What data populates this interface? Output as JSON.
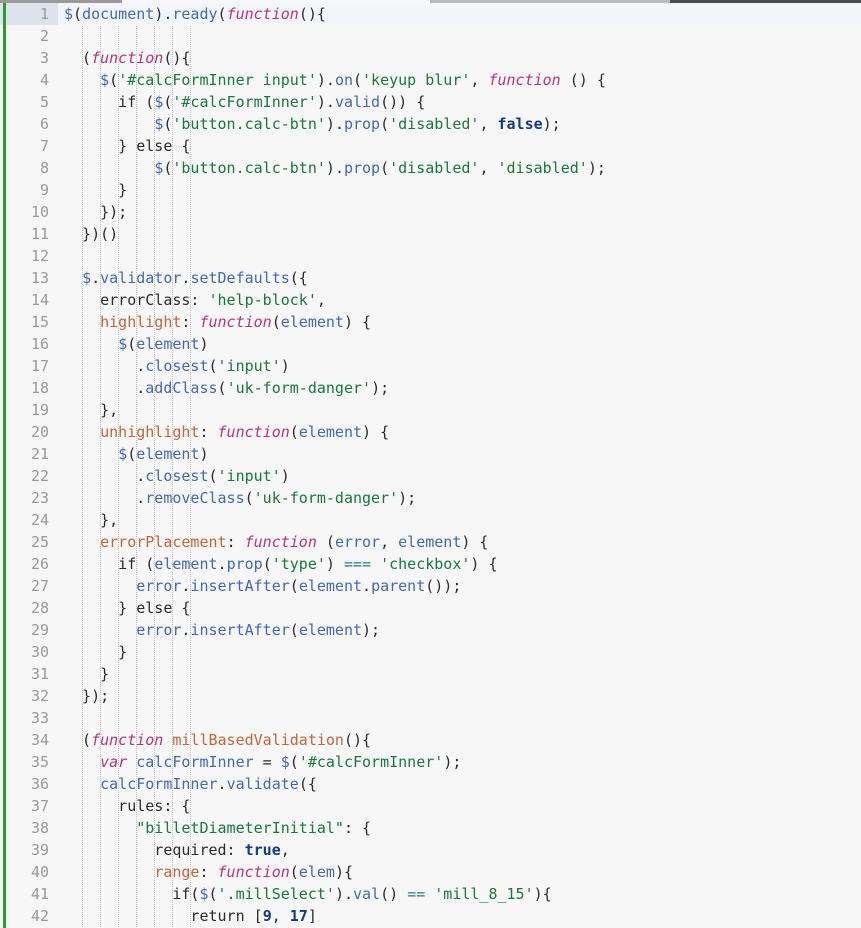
{
  "window": {
    "title": "Code Editor",
    "top_strip_segments": [
      "toolbar-left",
      "toolbar-mid",
      "toolbar-right"
    ]
  },
  "editor": {
    "language": "JavaScript",
    "caret_line": 1,
    "first_visible_line": 1,
    "last_visible_line": 42,
    "line_height_px": 22,
    "vcs_marker": "modified",
    "colors": {
      "background": "#f7f7f7",
      "gutter_text": "#999999",
      "caret_line_gutter": "#dde3ec",
      "vcs_modified": "#2e9b2e",
      "identifier": "#4169b4",
      "string": "#157a3a",
      "keyword": "#b8337e",
      "function_name": "#c1663a",
      "property_key": "#c1663a",
      "constant": "#0f3c84",
      "operator": "#20808d",
      "plain": "#2b2b2b",
      "indent_guide": "#c4c4c4"
    }
  },
  "code": {
    "lines": [
      {
        "n": 1,
        "tokens": [
          {
            "t": "$",
            "c": "ident"
          },
          {
            "t": "(",
            "c": "punc"
          },
          {
            "t": "document",
            "c": "ident"
          },
          {
            "t": ")",
            "c": "punc"
          },
          {
            "t": ".",
            "c": "punc"
          },
          {
            "t": "ready",
            "c": "call"
          },
          {
            "t": "(",
            "c": "punc"
          },
          {
            "t": "function",
            "c": "kw"
          },
          {
            "t": "(){",
            "c": "punc"
          }
        ]
      },
      {
        "n": 2,
        "tokens": []
      },
      {
        "n": 3,
        "tokens": [
          {
            "t": "  (",
            "c": "punc"
          },
          {
            "t": "function",
            "c": "kw"
          },
          {
            "t": "(){",
            "c": "punc"
          }
        ]
      },
      {
        "n": 4,
        "tokens": [
          {
            "t": "    ",
            "c": "plain"
          },
          {
            "t": "$",
            "c": "ident"
          },
          {
            "t": "(",
            "c": "punc"
          },
          {
            "t": "'#calcFormInner input'",
            "c": "str"
          },
          {
            "t": ")",
            "c": "punc"
          },
          {
            "t": ".",
            "c": "punc"
          },
          {
            "t": "on",
            "c": "call"
          },
          {
            "t": "(",
            "c": "punc"
          },
          {
            "t": "'keyup blur'",
            "c": "str"
          },
          {
            "t": ", ",
            "c": "punc"
          },
          {
            "t": "function",
            "c": "kw"
          },
          {
            "t": " () {",
            "c": "punc"
          }
        ]
      },
      {
        "n": 5,
        "tokens": [
          {
            "t": "      if (",
            "c": "plain"
          },
          {
            "t": "$",
            "c": "ident"
          },
          {
            "t": "(",
            "c": "punc"
          },
          {
            "t": "'#calcFormInner'",
            "c": "str"
          },
          {
            "t": ")",
            "c": "punc"
          },
          {
            "t": ".",
            "c": "punc"
          },
          {
            "t": "valid",
            "c": "call"
          },
          {
            "t": "()) {",
            "c": "punc"
          }
        ]
      },
      {
        "n": 6,
        "tokens": [
          {
            "t": "          ",
            "c": "plain"
          },
          {
            "t": "$",
            "c": "ident"
          },
          {
            "t": "(",
            "c": "punc"
          },
          {
            "t": "'button.calc-btn'",
            "c": "str"
          },
          {
            "t": ")",
            "c": "punc"
          },
          {
            "t": ".",
            "c": "punc"
          },
          {
            "t": "prop",
            "c": "call"
          },
          {
            "t": "(",
            "c": "punc"
          },
          {
            "t": "'disabled'",
            "c": "str"
          },
          {
            "t": ", ",
            "c": "punc"
          },
          {
            "t": "false",
            "c": "const"
          },
          {
            "t": ");",
            "c": "punc"
          }
        ]
      },
      {
        "n": 7,
        "tokens": [
          {
            "t": "      } else {",
            "c": "plain"
          }
        ]
      },
      {
        "n": 8,
        "tokens": [
          {
            "t": "          ",
            "c": "plain"
          },
          {
            "t": "$",
            "c": "ident"
          },
          {
            "t": "(",
            "c": "punc"
          },
          {
            "t": "'button.calc-btn'",
            "c": "str"
          },
          {
            "t": ")",
            "c": "punc"
          },
          {
            "t": ".",
            "c": "punc"
          },
          {
            "t": "prop",
            "c": "call"
          },
          {
            "t": "(",
            "c": "punc"
          },
          {
            "t": "'disabled'",
            "c": "str"
          },
          {
            "t": ", ",
            "c": "punc"
          },
          {
            "t": "'disabled'",
            "c": "str"
          },
          {
            "t": ");",
            "c": "punc"
          }
        ]
      },
      {
        "n": 9,
        "tokens": [
          {
            "t": "      }",
            "c": "plain"
          }
        ]
      },
      {
        "n": 10,
        "tokens": [
          {
            "t": "    });",
            "c": "punc"
          }
        ]
      },
      {
        "n": 11,
        "tokens": [
          {
            "t": "  })()",
            "c": "punc"
          }
        ]
      },
      {
        "n": 12,
        "tokens": []
      },
      {
        "n": 13,
        "tokens": [
          {
            "t": "  ",
            "c": "plain"
          },
          {
            "t": "$",
            "c": "ident"
          },
          {
            "t": ".",
            "c": "punc"
          },
          {
            "t": "validator",
            "c": "ident"
          },
          {
            "t": ".",
            "c": "punc"
          },
          {
            "t": "setDefaults",
            "c": "call"
          },
          {
            "t": "({",
            "c": "punc"
          }
        ]
      },
      {
        "n": 14,
        "tokens": [
          {
            "t": "    errorClass: ",
            "c": "plain"
          },
          {
            "t": "'help-block'",
            "c": "str"
          },
          {
            "t": ",",
            "c": "punc"
          }
        ]
      },
      {
        "n": 15,
        "tokens": [
          {
            "t": "    ",
            "c": "plain"
          },
          {
            "t": "highlight",
            "c": "prop"
          },
          {
            "t": ": ",
            "c": "punc"
          },
          {
            "t": "function",
            "c": "kw"
          },
          {
            "t": "(",
            "c": "punc"
          },
          {
            "t": "element",
            "c": "ident"
          },
          {
            "t": ") {",
            "c": "punc"
          }
        ]
      },
      {
        "n": 16,
        "tokens": [
          {
            "t": "      ",
            "c": "plain"
          },
          {
            "t": "$",
            "c": "ident"
          },
          {
            "t": "(",
            "c": "punc"
          },
          {
            "t": "element",
            "c": "ident"
          },
          {
            "t": ")",
            "c": "punc"
          }
        ]
      },
      {
        "n": 17,
        "tokens": [
          {
            "t": "        .",
            "c": "punc"
          },
          {
            "t": "closest",
            "c": "call"
          },
          {
            "t": "(",
            "c": "punc"
          },
          {
            "t": "'input'",
            "c": "str"
          },
          {
            "t": ")",
            "c": "punc"
          }
        ]
      },
      {
        "n": 18,
        "tokens": [
          {
            "t": "        .",
            "c": "punc"
          },
          {
            "t": "addClass",
            "c": "call"
          },
          {
            "t": "(",
            "c": "punc"
          },
          {
            "t": "'uk-form-danger'",
            "c": "str"
          },
          {
            "t": ");",
            "c": "punc"
          }
        ]
      },
      {
        "n": 19,
        "tokens": [
          {
            "t": "    },",
            "c": "punc"
          }
        ]
      },
      {
        "n": 20,
        "tokens": [
          {
            "t": "    ",
            "c": "plain"
          },
          {
            "t": "unhighlight",
            "c": "prop"
          },
          {
            "t": ": ",
            "c": "punc"
          },
          {
            "t": "function",
            "c": "kw"
          },
          {
            "t": "(",
            "c": "punc"
          },
          {
            "t": "element",
            "c": "ident"
          },
          {
            "t": ") {",
            "c": "punc"
          }
        ]
      },
      {
        "n": 21,
        "tokens": [
          {
            "t": "      ",
            "c": "plain"
          },
          {
            "t": "$",
            "c": "ident"
          },
          {
            "t": "(",
            "c": "punc"
          },
          {
            "t": "element",
            "c": "ident"
          },
          {
            "t": ")",
            "c": "punc"
          }
        ]
      },
      {
        "n": 22,
        "tokens": [
          {
            "t": "        .",
            "c": "punc"
          },
          {
            "t": "closest",
            "c": "call"
          },
          {
            "t": "(",
            "c": "punc"
          },
          {
            "t": "'input'",
            "c": "str"
          },
          {
            "t": ")",
            "c": "punc"
          }
        ]
      },
      {
        "n": 23,
        "tokens": [
          {
            "t": "        .",
            "c": "punc"
          },
          {
            "t": "removeClass",
            "c": "call"
          },
          {
            "t": "(",
            "c": "punc"
          },
          {
            "t": "'uk-form-danger'",
            "c": "str"
          },
          {
            "t": ");",
            "c": "punc"
          }
        ]
      },
      {
        "n": 24,
        "tokens": [
          {
            "t": "    },",
            "c": "punc"
          }
        ]
      },
      {
        "n": 25,
        "tokens": [
          {
            "t": "    ",
            "c": "plain"
          },
          {
            "t": "errorPlacement",
            "c": "prop"
          },
          {
            "t": ": ",
            "c": "punc"
          },
          {
            "t": "function",
            "c": "kw"
          },
          {
            "t": " (",
            "c": "punc"
          },
          {
            "t": "error",
            "c": "ident"
          },
          {
            "t": ", ",
            "c": "punc"
          },
          {
            "t": "element",
            "c": "ident"
          },
          {
            "t": ") {",
            "c": "punc"
          }
        ]
      },
      {
        "n": 26,
        "tokens": [
          {
            "t": "      if (",
            "c": "plain"
          },
          {
            "t": "element",
            "c": "ident"
          },
          {
            "t": ".",
            "c": "punc"
          },
          {
            "t": "prop",
            "c": "call"
          },
          {
            "t": "(",
            "c": "punc"
          },
          {
            "t": "'type'",
            "c": "str"
          },
          {
            "t": ") ",
            "c": "punc"
          },
          {
            "t": "===",
            "c": "op"
          },
          {
            "t": " ",
            "c": "punc"
          },
          {
            "t": "'checkbox'",
            "c": "str"
          },
          {
            "t": ") {",
            "c": "punc"
          }
        ]
      },
      {
        "n": 27,
        "tokens": [
          {
            "t": "        ",
            "c": "plain"
          },
          {
            "t": "error",
            "c": "ident"
          },
          {
            "t": ".",
            "c": "punc"
          },
          {
            "t": "insertAfter",
            "c": "call"
          },
          {
            "t": "(",
            "c": "punc"
          },
          {
            "t": "element",
            "c": "ident"
          },
          {
            "t": ".",
            "c": "punc"
          },
          {
            "t": "parent",
            "c": "call"
          },
          {
            "t": "());",
            "c": "punc"
          }
        ]
      },
      {
        "n": 28,
        "tokens": [
          {
            "t": "      } else {",
            "c": "plain"
          }
        ]
      },
      {
        "n": 29,
        "tokens": [
          {
            "t": "        ",
            "c": "plain"
          },
          {
            "t": "error",
            "c": "ident"
          },
          {
            "t": ".",
            "c": "punc"
          },
          {
            "t": "insertAfter",
            "c": "call"
          },
          {
            "t": "(",
            "c": "punc"
          },
          {
            "t": "element",
            "c": "ident"
          },
          {
            "t": ");",
            "c": "punc"
          }
        ]
      },
      {
        "n": 30,
        "tokens": [
          {
            "t": "      }",
            "c": "plain"
          }
        ]
      },
      {
        "n": 31,
        "tokens": [
          {
            "t": "    }",
            "c": "punc"
          }
        ]
      },
      {
        "n": 32,
        "tokens": [
          {
            "t": "  });",
            "c": "punc"
          }
        ]
      },
      {
        "n": 33,
        "tokens": []
      },
      {
        "n": 34,
        "tokens": [
          {
            "t": "  (",
            "c": "punc"
          },
          {
            "t": "function",
            "c": "kw"
          },
          {
            "t": " ",
            "c": "punc"
          },
          {
            "t": "millBasedValidation",
            "c": "fnname"
          },
          {
            "t": "(){",
            "c": "punc"
          }
        ]
      },
      {
        "n": 35,
        "tokens": [
          {
            "t": "    ",
            "c": "plain"
          },
          {
            "t": "var",
            "c": "kw"
          },
          {
            "t": " ",
            "c": "punc"
          },
          {
            "t": "calcFormInner",
            "c": "ident"
          },
          {
            "t": " = ",
            "c": "punc"
          },
          {
            "t": "$",
            "c": "ident"
          },
          {
            "t": "(",
            "c": "punc"
          },
          {
            "t": "'#calcFormInner'",
            "c": "str"
          },
          {
            "t": ");",
            "c": "punc"
          }
        ]
      },
      {
        "n": 36,
        "tokens": [
          {
            "t": "    ",
            "c": "plain"
          },
          {
            "t": "calcFormInner",
            "c": "ident"
          },
          {
            "t": ".",
            "c": "punc"
          },
          {
            "t": "validate",
            "c": "call"
          },
          {
            "t": "({",
            "c": "punc"
          }
        ]
      },
      {
        "n": 37,
        "tokens": [
          {
            "t": "      rules: {",
            "c": "plain"
          }
        ]
      },
      {
        "n": 38,
        "tokens": [
          {
            "t": "        ",
            "c": "plain"
          },
          {
            "t": "\"billetDiameterInitial\"",
            "c": "str"
          },
          {
            "t": ": {",
            "c": "punc"
          }
        ]
      },
      {
        "n": 39,
        "tokens": [
          {
            "t": "          required: ",
            "c": "plain"
          },
          {
            "t": "true",
            "c": "const"
          },
          {
            "t": ",",
            "c": "punc"
          }
        ]
      },
      {
        "n": 40,
        "tokens": [
          {
            "t": "          ",
            "c": "plain"
          },
          {
            "t": "range",
            "c": "prop"
          },
          {
            "t": ": ",
            "c": "punc"
          },
          {
            "t": "function",
            "c": "kw"
          },
          {
            "t": "(",
            "c": "punc"
          },
          {
            "t": "elem",
            "c": "ident"
          },
          {
            "t": "){",
            "c": "punc"
          }
        ]
      },
      {
        "n": 41,
        "tokens": [
          {
            "t": "            if(",
            "c": "plain"
          },
          {
            "t": "$",
            "c": "ident"
          },
          {
            "t": "(",
            "c": "punc"
          },
          {
            "t": "'.millSelect'",
            "c": "str"
          },
          {
            "t": ")",
            "c": "punc"
          },
          {
            "t": ".",
            "c": "punc"
          },
          {
            "t": "val",
            "c": "call"
          },
          {
            "t": "() ",
            "c": "punc"
          },
          {
            "t": "==",
            "c": "op"
          },
          {
            "t": " ",
            "c": "punc"
          },
          {
            "t": "'mill_8_15'",
            "c": "str"
          },
          {
            "t": "){",
            "c": "punc"
          }
        ]
      },
      {
        "n": 42,
        "tokens": [
          {
            "t": "              return [",
            "c": "plain"
          },
          {
            "t": "9",
            "c": "const"
          },
          {
            "t": ", ",
            "c": "punc"
          },
          {
            "t": "17",
            "c": "const"
          },
          {
            "t": "]",
            "c": "punc"
          }
        ]
      }
    ],
    "indent_guide_columns": [
      2,
      4,
      6,
      8,
      10,
      12,
      14
    ]
  }
}
